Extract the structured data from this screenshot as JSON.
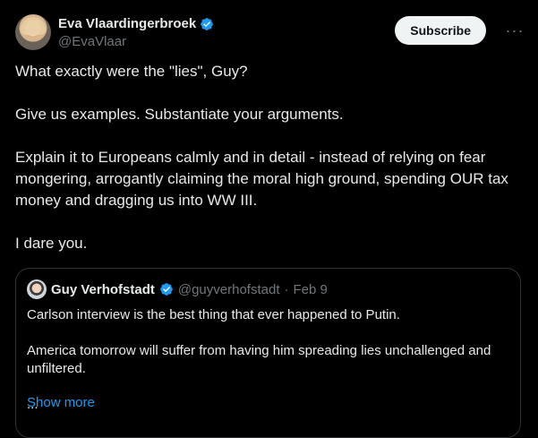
{
  "tweet": {
    "author": {
      "display_name": "Eva Vlaardingerbroek",
      "handle": "@EvaVlaar",
      "verified_icon": "verified-badge-icon"
    },
    "subscribe_label": "Subscribe",
    "more_label": "···",
    "paragraphs": [
      "What exactly were the \"lies\", Guy?",
      "Give us examples. Substantiate your arguments.",
      "Explain it to Europeans calmly and in detail - instead of relying on fear mongering, arrogantly claiming the moral high ground, spending OUR tax money and dragging us into WW III.",
      "I dare you."
    ]
  },
  "quoted_tweet": {
    "author": {
      "display_name": "Guy Verhofstadt",
      "handle": "@guyverhofstadt",
      "separator": "·",
      "date": "Feb 9"
    },
    "paragraphs": [
      "Carlson interview is the best thing that ever happened to Putin.",
      "America tomorrow will suffer from having him spreading lies unchallenged and unfiltered.",
      "..."
    ],
    "show_more_label": "Show more"
  },
  "colors": {
    "background": "#000000",
    "text": "#e7e9ea",
    "secondary": "#71767b",
    "accent": "#1d9bf0",
    "border": "#2f3336"
  }
}
